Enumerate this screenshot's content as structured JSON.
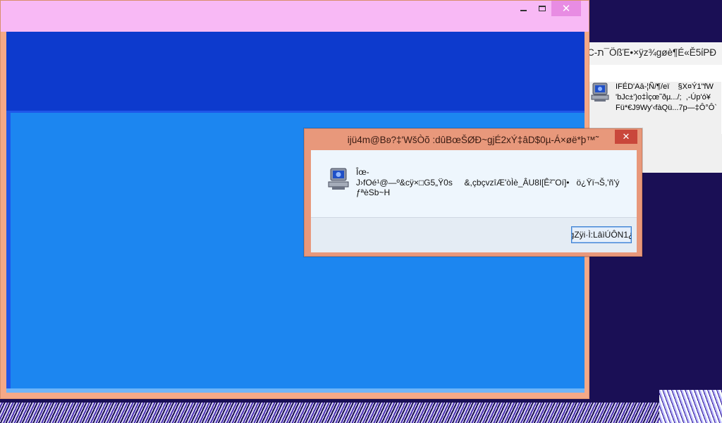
{
  "main_window": {
    "minimize_glyph": "",
    "close_glyph": "✕"
  },
  "back_window": {
    "title": "C-ת¯ÖßΈ•×ÿz¾gøè¶É«Ě5ίΡĐ",
    "message": "ΙFÉD'Aā-¦Ñ/¶/eï    §X¤Ý1\"fW\n'bJc±')o‡Ìçœ˜ðµ.../;  ,-Úp'ó¥\nFü*€J9Wy'‹fàQü...7p—‡Ô°Ô`"
  },
  "dialog": {
    "title": "ijü4m@Bʚ?‡'WšÒõ     :dûBœŠØĐ~gjÉ2xÝ‡âD$0µ-Á×øë*þ™˜",
    "close_glyph": "✕",
    "message": "Îœ-\nJ›fOé¹@—º&cÿ×□G5„Ÿ0s     &,çbçvzîÆ'òÌè_ÂU8ǀ[Ê²˜Oí]•   ö¿Ÿï¬Š,'ñ'ý\nƒªèSb~H",
    "button_label": "gZÿi·Ì:LâìÚÔN1¿"
  },
  "icons": {
    "dialog_icon": "computer-icon",
    "back_icon": "computer-icon"
  },
  "colors": {
    "main_title_bg": "#f8b9f5",
    "client_dark": "#0d3acd",
    "client_light": "#1c86f0",
    "dialog_frame": "#e8987b",
    "desktop_bg": "#1a0f55"
  }
}
